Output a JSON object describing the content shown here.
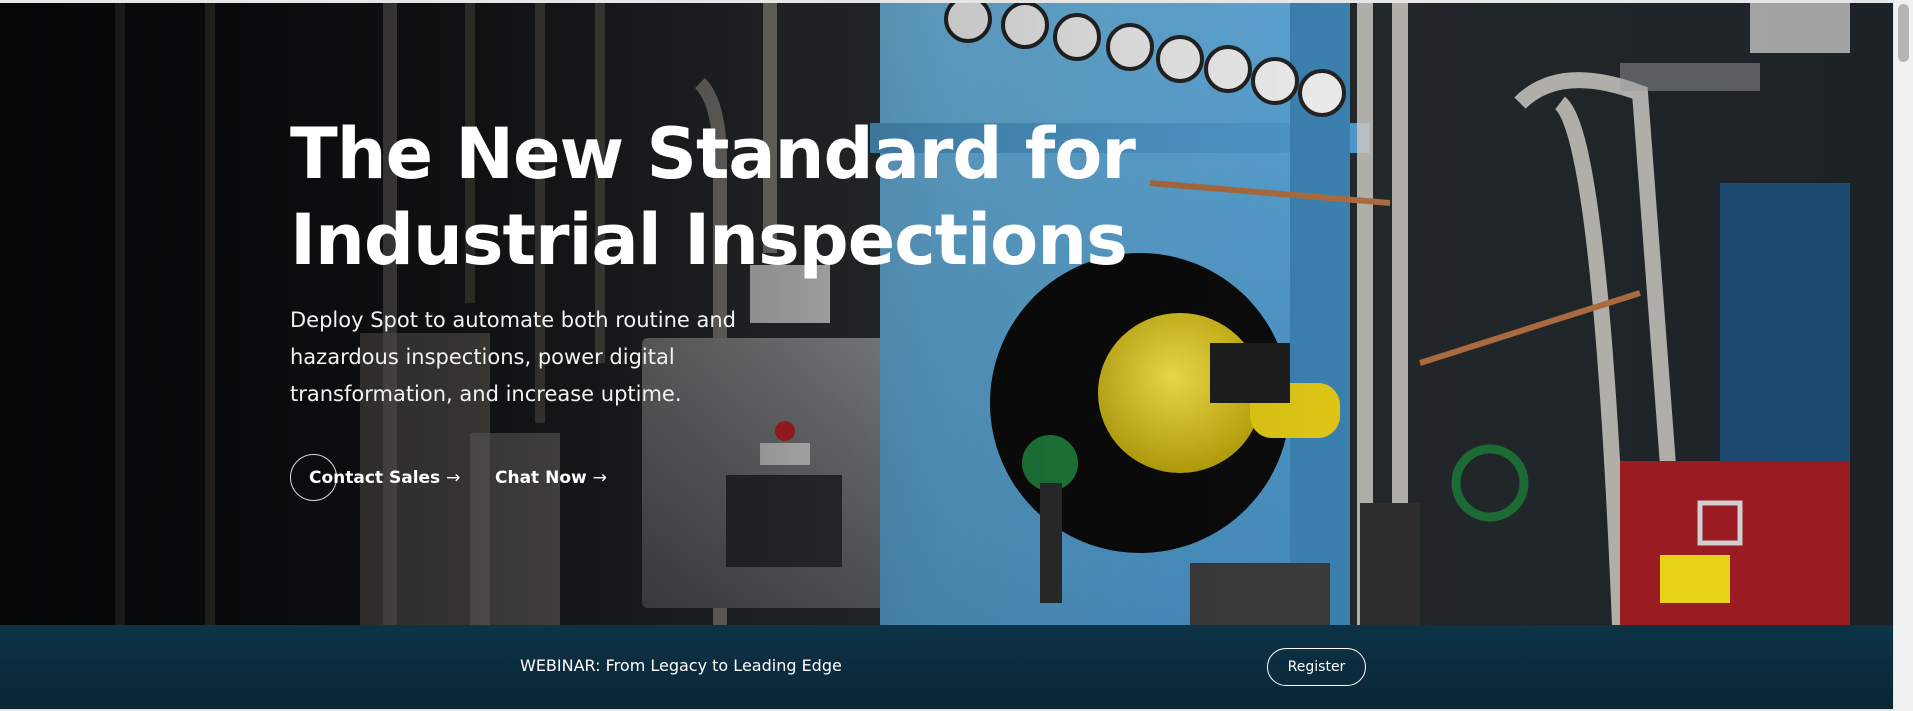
{
  "hero": {
    "title_line1": "The New Standard for",
    "title_line2": "Industrial Inspections",
    "subtitle": "Deploy Spot to automate both routine and hazardous inspections, power digital transformation, and increase uptime.",
    "image_description_icon": "industrial-generator-image",
    "cta": {
      "contact_label": "Contact Sales",
      "contact_arrow": "→",
      "chat_label": "Chat Now",
      "chat_arrow": "→"
    }
  },
  "banner": {
    "text": "WEBINAR: From Legacy to Leading Edge",
    "button_label": "Register"
  },
  "colors": {
    "hero_text": "#ffffff",
    "banner_bg": "#0b2c3e",
    "machine_blue": "#5da9d6",
    "burner_yellow": "#e6cf1a",
    "cabinet_red": "#9b1b22"
  }
}
